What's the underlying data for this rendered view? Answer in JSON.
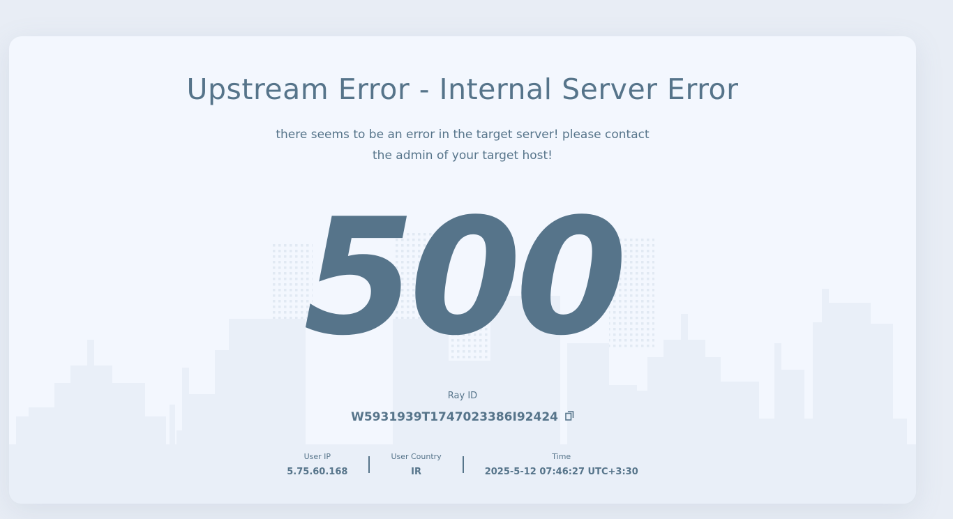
{
  "error": {
    "title": "Upstream Error - Internal Server Error",
    "message_line1": "there seems to be an error in the target server! please contact",
    "message_line2": "the admin of your target host!",
    "code": "500"
  },
  "ray": {
    "label": "Ray ID",
    "id": "W5931939T1747023386I92424",
    "copy_icon": "copy-icon"
  },
  "details": {
    "user_ip_label": "User IP",
    "user_ip": "5.75.60.168",
    "country_label": "User Country",
    "country": "IR",
    "time_label": "Time",
    "time": "2025-5-12 07:46:27 UTC+3:30"
  },
  "colors": {
    "primary": "#56748a",
    "background": "#e8edf5",
    "card": "#f3f7fe",
    "skyline": "#e9eff8"
  }
}
